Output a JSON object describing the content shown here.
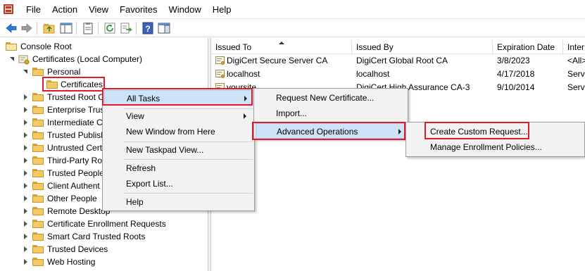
{
  "menubar": {
    "items": [
      "File",
      "Action",
      "View",
      "Favorites",
      "Window",
      "Help"
    ]
  },
  "tree": {
    "items": [
      {
        "label": "Console Root"
      },
      {
        "label": "Certificates (Local Computer)"
      },
      {
        "label": "Personal"
      },
      {
        "label": "Certificates"
      },
      {
        "label": "Trusted Root C"
      },
      {
        "label": "Enterprise Trus"
      },
      {
        "label": "Intermediate C"
      },
      {
        "label": "Trusted Publish"
      },
      {
        "label": "Untrusted Cert"
      },
      {
        "label": "Third-Party Ro"
      },
      {
        "label": "Trusted People"
      },
      {
        "label": "Client Authent"
      },
      {
        "label": "Other People"
      },
      {
        "label": "Remote Desktop"
      },
      {
        "label": "Certificate Enrollment Requests"
      },
      {
        "label": "Smart Card Trusted Roots"
      },
      {
        "label": "Trusted Devices"
      },
      {
        "label": "Web Hosting"
      }
    ]
  },
  "list": {
    "columns": [
      "Issued To",
      "Issued By",
      "Expiration Date",
      "Inter"
    ],
    "rows": [
      {
        "issued_to": "DigiCert Secure Server CA",
        "issued_by": "DigiCert Global Root CA",
        "expiration": "3/8/2023",
        "intended": "<All>"
      },
      {
        "issued_to": "localhost",
        "issued_by": "localhost",
        "expiration": "4/17/2018",
        "intended": "Serve"
      },
      {
        "issued_to": "yoursite",
        "issued_by": "DigiCert High Assurance CA-3",
        "expiration": "9/10/2014",
        "intended": "Serve"
      }
    ]
  },
  "context_menu_main": {
    "items": [
      "All Tasks",
      "View",
      "New Window from Here",
      "New Taskpad View...",
      "Refresh",
      "Export List...",
      "Help"
    ]
  },
  "context_menu_all_tasks": {
    "items": [
      "Request New Certificate...",
      "Import...",
      "Advanced Operations"
    ]
  },
  "context_menu_advanced": {
    "items": [
      "Create Custom Request...",
      "Manage Enrollment Policies..."
    ]
  },
  "colors": {
    "highlight_border": "#e21a2c",
    "menu_highlight": "#cde3f7"
  }
}
